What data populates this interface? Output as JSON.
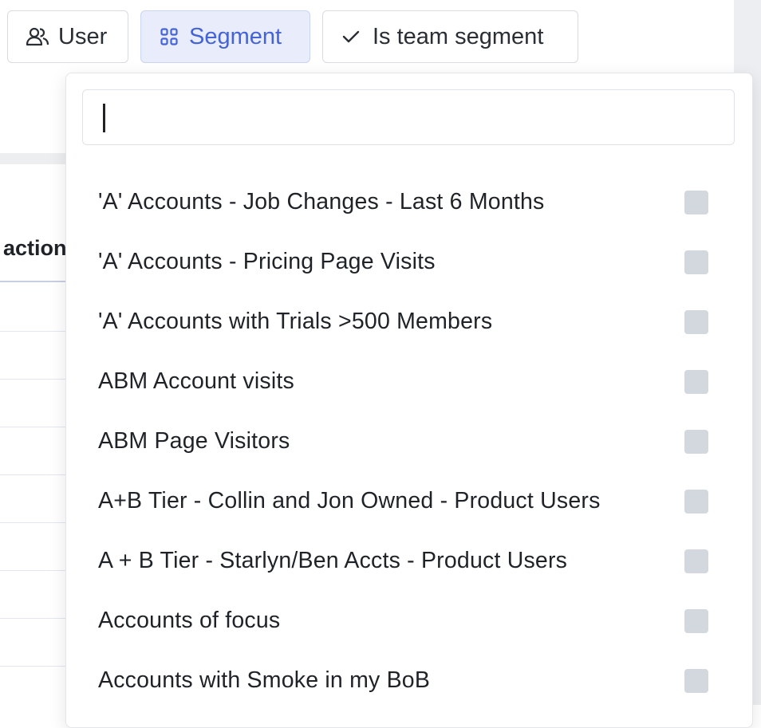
{
  "toolbar": {
    "chips": [
      {
        "label": "User",
        "icon": "users-icon"
      },
      {
        "label": "Segment",
        "icon": "grid-icon",
        "active": true
      },
      {
        "label": "Is team segment",
        "icon": "check-icon"
      }
    ]
  },
  "background_table": {
    "header_label": "action"
  },
  "dropdown": {
    "search": {
      "value": "",
      "placeholder": ""
    },
    "options": [
      {
        "label": "'A' Accounts - Job Changes - Last 6 Months",
        "checked": false
      },
      {
        "label": "'A' Accounts - Pricing Page Visits",
        "checked": false
      },
      {
        "label": "'A' Accounts with Trials >500 Members",
        "checked": false
      },
      {
        "label": "ABM Account visits",
        "checked": false
      },
      {
        "label": "ABM Page Visitors",
        "checked": false
      },
      {
        "label": "A+B Tier - Collin and Jon Owned - Product Users",
        "checked": false
      },
      {
        "label": "A + B Tier - Starlyn/Ben Accts - Product Users",
        "checked": false
      },
      {
        "label": "Accounts of focus",
        "checked": false
      },
      {
        "label": "Accounts with Smoke in my BoB",
        "checked": false
      }
    ]
  },
  "colors": {
    "accent": "#4563d6",
    "accent_bg": "#e9edfb",
    "checkbox": "#d3d7de"
  }
}
